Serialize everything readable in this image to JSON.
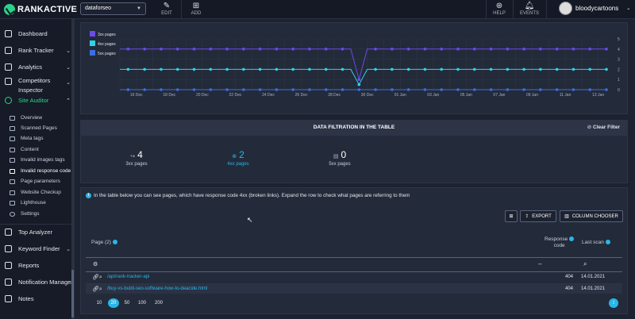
{
  "app": {
    "brand": "RANKACTIVE"
  },
  "toolbar": {
    "project": "dataforseo",
    "edit": "EDIT",
    "add": "ADD",
    "help": "HELP",
    "events": "EVENTS",
    "user": "bloodycartoons"
  },
  "sidebar": {
    "items": [
      {
        "label": "Dashboard",
        "icon": "gauge-icon"
      },
      {
        "label": "Rank Tracker",
        "icon": "trophy-icon"
      },
      {
        "label": "Analytics",
        "icon": "chart-icon"
      },
      {
        "label": "Competitors Inspector",
        "icon": "users-icon"
      },
      {
        "label": "Site Auditor",
        "icon": "crosshair-icon"
      },
      {
        "label": "Top Analyzer",
        "icon": "top-icon"
      },
      {
        "label": "Keyword Finder",
        "icon": "key-icon"
      },
      {
        "label": "Reports",
        "icon": "report-icon"
      },
      {
        "label": "Notification Manager",
        "icon": "bell-icon"
      },
      {
        "label": "Notes",
        "icon": "note-icon"
      }
    ],
    "competitors_line1": "Competitors",
    "competitors_line2": "Inspector",
    "subitems": [
      "Overview",
      "Scanned Pages",
      "Meta tags",
      "Content",
      "Invalid images tags",
      "Invalid response code",
      "Page parameters",
      "Website Checkup",
      "Lighthouse",
      "Settings"
    ]
  },
  "chart_data": {
    "type": "line",
    "x": [
      "16 Dec",
      "18 Dec",
      "20 Dec",
      "22 Dec",
      "24 Dec",
      "26 Dec",
      "28 Dec",
      "30 Dec",
      "01 Jan",
      "03 Jan",
      "05 Jan",
      "07 Jan",
      "09 Jan",
      "11 Jan",
      "13 Jan"
    ],
    "ylim": [
      0,
      5
    ],
    "yticks": [
      0,
      1,
      2,
      3,
      4,
      5
    ],
    "series": [
      {
        "name": "3xx pages",
        "color": "#6a4ce8",
        "values": [
          4,
          4,
          4,
          4,
          4,
          4,
          4,
          4,
          4,
          4,
          4,
          4,
          4,
          4,
          4,
          4,
          4,
          4,
          4,
          4,
          4,
          4,
          4,
          4,
          4,
          4,
          4,
          4,
          4,
          4,
          4,
          4,
          4,
          4,
          4,
          4,
          4,
          4,
          4,
          4,
          4,
          4,
          4,
          4,
          4,
          4,
          4,
          4,
          4,
          4,
          4,
          4,
          4,
          4,
          4,
          4,
          4,
          4,
          4,
          4
        ],
        "dip": {
          "index": 29,
          "value": 1
        }
      },
      {
        "name": "4xx pages",
        "color": "#2fd3e8",
        "values": [
          2,
          2,
          2,
          2,
          2,
          2,
          2,
          2,
          2,
          2,
          2,
          2,
          2,
          2,
          2,
          2,
          2,
          2,
          2,
          2,
          2,
          2,
          2,
          2,
          2,
          2,
          2,
          2,
          2,
          2,
          2,
          2,
          2,
          2,
          2,
          2,
          2,
          2,
          2,
          2,
          2,
          2,
          2,
          2,
          2,
          2,
          2,
          2,
          2,
          2,
          2,
          2,
          2,
          2,
          2,
          2,
          2,
          2,
          2,
          2
        ],
        "dip": {
          "index": 29,
          "value": 0.5
        }
      },
      {
        "name": "5xx pages",
        "color": "#3a6fe0",
        "values": [
          0,
          0,
          0,
          0,
          0,
          0,
          0,
          0,
          0,
          0,
          0,
          0,
          0,
          0,
          0,
          0,
          0,
          0,
          0,
          0,
          0,
          0,
          0,
          0,
          0,
          0,
          0,
          0,
          0,
          0,
          0,
          0,
          0,
          0,
          0,
          0,
          0,
          0,
          0,
          0,
          0,
          0,
          0,
          0,
          0,
          0,
          0,
          0,
          0,
          0,
          0,
          0,
          0,
          0,
          0,
          0,
          0,
          0,
          0,
          0
        ]
      }
    ]
  },
  "filtration": {
    "title": "DATA FILTRATION IN THE TABLE",
    "clear": "Clear Filter",
    "stats": [
      {
        "count": "4",
        "label": "3xx pages",
        "icon": "3xx"
      },
      {
        "count": "2",
        "label": "4xx pages",
        "icon": "4xx"
      },
      {
        "count": "0",
        "label": "5xx pages",
        "icon": "5xx"
      }
    ]
  },
  "table": {
    "info": "In the table below you can see pages, which have response code 4xx (broken links). Expand the row to check what pages are referring to them",
    "export": "EXPORT",
    "column_chooser": "COLUMN CHOOSER",
    "col_page": "Page (2)",
    "col_code_1": "Response",
    "col_code_2": "code",
    "col_last": "Last scan",
    "rows": [
      {
        "url": "/api/rank-tracker-api",
        "code": "404",
        "date": "14.01.2021"
      },
      {
        "url": "/buy-vs-build-seo-software-how-to-deacide.html",
        "code": "404",
        "date": "14.01.2021"
      }
    ],
    "page_sizes": [
      "10",
      "20",
      "50",
      "100",
      "200"
    ],
    "active_size": "20"
  }
}
